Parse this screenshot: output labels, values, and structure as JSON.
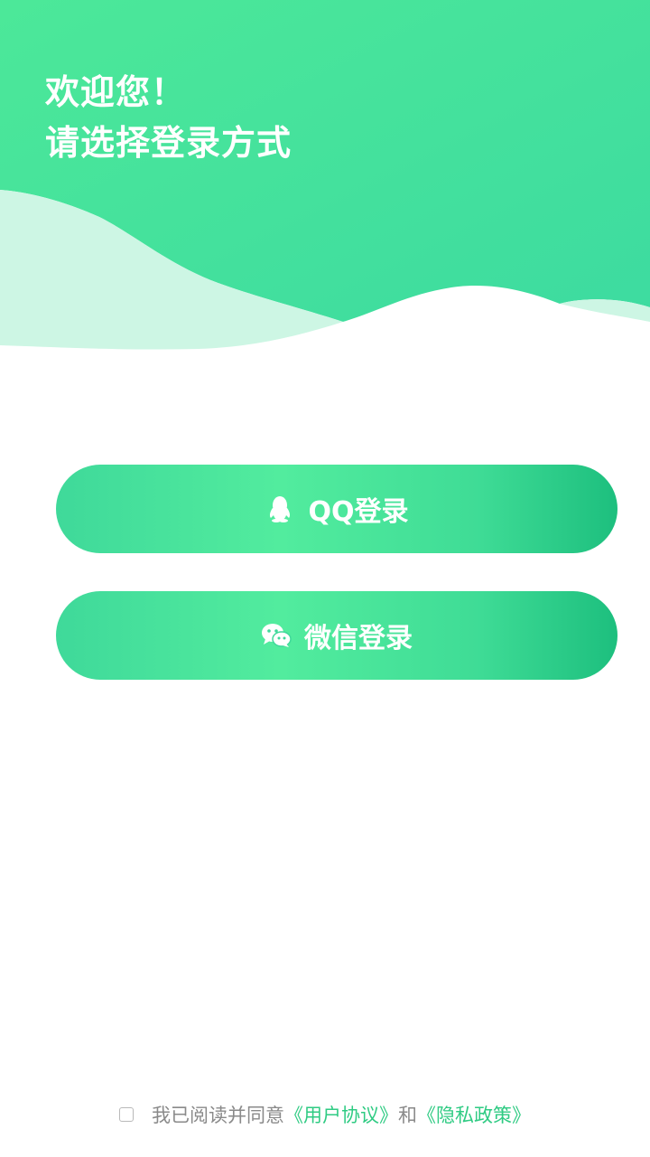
{
  "greeting": {
    "line1": "欢迎您！",
    "line2": "请选择登录方式"
  },
  "buttons": {
    "qq": {
      "label": "QQ登录",
      "icon": "qq-penguin-icon"
    },
    "wechat": {
      "label": "微信登录",
      "icon": "wechat-icon"
    }
  },
  "agreement": {
    "prefix": "我已阅读并同意",
    "user_agreement": "《用户协议》",
    "connector": "和",
    "privacy_policy": "《隐私政策》",
    "checked": false
  },
  "colors": {
    "header_gradient_start": "#4be79c",
    "header_gradient_end": "#3fdc9f",
    "wave_light": "#cdf6e4",
    "button_start": "#3fd99a",
    "button_end": "#1dbf7e",
    "link": "#2fcb83"
  }
}
